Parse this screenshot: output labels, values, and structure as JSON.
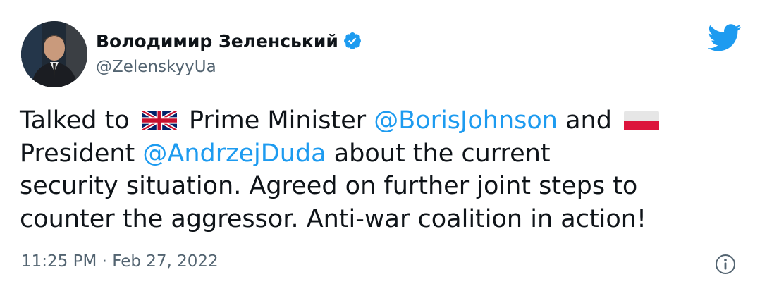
{
  "tweet": {
    "author": {
      "display_name": "Володимир Зеленський",
      "handle": "@ZelenskyyUa",
      "verified_icon": "verified-badge-icon",
      "avatar_icon": "profile-photo"
    },
    "text": {
      "line1_a": "Talked to ",
      "line1_b": " Prime Minister ",
      "mention_1": "@BorisJohnson",
      "line1_c": " and ",
      "line2_a": " President ",
      "mention_2": "@AndrzejDuda",
      "line2_b": " about the current",
      "line3": "security situation. Agreed on further joint steps to",
      "line4": "counter the aggressor. Anti-war coalition in action!"
    },
    "flags": [
      "uk-flag-icon",
      "poland-flag-icon"
    ],
    "timestamp": "11:25 PM · Feb 27, 2022",
    "brand_icon": "twitter-bird-icon",
    "info_icon": "info-icon",
    "colors": {
      "link": "#1d9bf0",
      "text": "#0f1419",
      "secondary": "#536471",
      "verified": "#1d9bf0"
    }
  }
}
